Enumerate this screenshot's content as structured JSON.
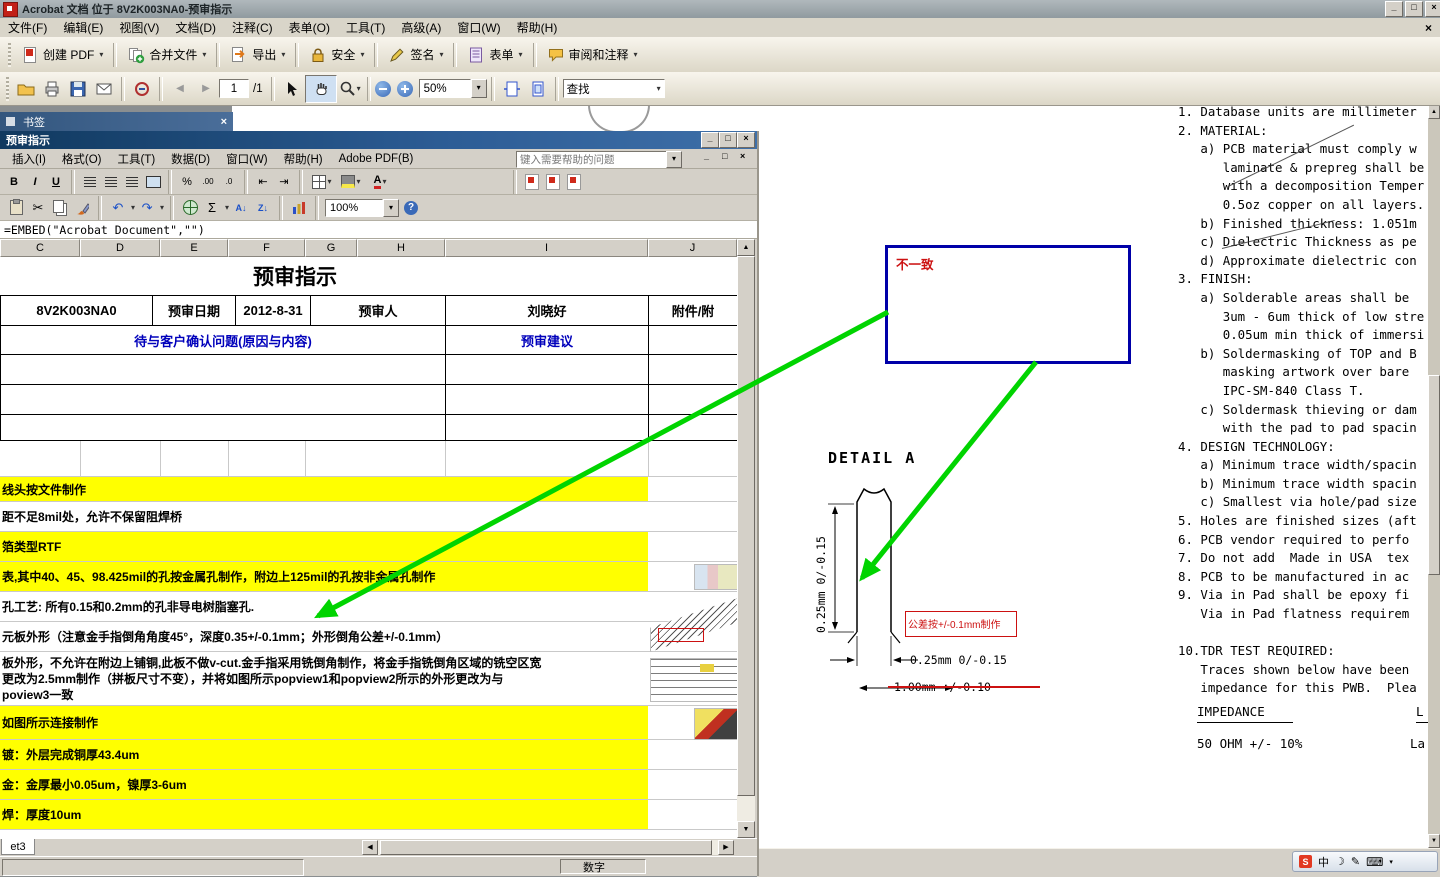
{
  "colors": {
    "c-hl": "#ffff00",
    "c-arrow": "#00d400",
    "c-callout": "#0000a8",
    "c-red": "#cc1111",
    "c-blue-text": "#0000bb"
  },
  "icons": {
    "min": "_",
    "max": "□",
    "close": "×",
    "dd": "▾",
    "up": "▲",
    "down": "▼",
    "left": "◀",
    "right": "▶",
    "bold": "B",
    "italic": "I",
    "underline": "U",
    "percent": "%",
    "dec_inc": ".00",
    "dec_dec": ".0",
    "indent_dec": "⇤",
    "indent_inc": "⇥",
    "scissors": "✂",
    "undo": "↶",
    "redo": "↷",
    "sum": "Σ",
    "help": "?",
    "fontA": "A",
    "sort_az": "A↓",
    "sort_za": "Z↓",
    "sogou": "S",
    "lang": "中",
    "moon": "☽",
    "pen": "✎",
    "keyboard": "⌨"
  },
  "window": {
    "title": "Acrobat 文档 位于 8V2K003NA0-预审指示"
  },
  "menubar": {
    "items": [
      "文件(F)",
      "编辑(E)",
      "视图(V)",
      "文档(D)",
      "注释(C)",
      "表单(O)",
      "工具(T)",
      "高级(A)",
      "窗口(W)",
      "帮助(H)"
    ]
  },
  "taskbar": {
    "buttons": [
      "创建 PDF",
      "合并文件",
      "导出",
      "安全",
      "签名",
      "表单",
      "审阅和注释"
    ]
  },
  "toolbar": {
    "page_value": "1",
    "page_total": "/1",
    "zoom_value": "50%",
    "find_value": "查找"
  },
  "nav": {
    "bookmarks": "书签"
  },
  "excel": {
    "title": "预审指示",
    "menu": [
      "插入(I)",
      "格式(O)",
      "工具(T)",
      "数据(D)",
      "窗口(W)",
      "帮助(H)",
      "Adobe PDF(B)"
    ],
    "help_placeholder": "键入需要帮助的问题",
    "zoom": "100%",
    "formula": "=EMBED(\"Acrobat Document\",\"\")",
    "columns": [
      "C",
      "D",
      "E",
      "F",
      "G",
      "H",
      "I",
      "J"
    ],
    "sheet": {
      "title": "预审指示",
      "info_row": {
        "part": "8V2K003NA0",
        "date_label": "预审日期",
        "date": "2012-8-31",
        "reviewer_label": "预审人",
        "reviewer": "刘晓好",
        "attach_label": "附件/附"
      },
      "section_row": {
        "left": "待与客户确认问题(原因与内容)",
        "right": "预审建议"
      },
      "rows": [
        {
          "text": "线头按文件制作",
          "highlight": true
        },
        {
          "text": "距不足8mil处，允许不保留阻焊桥",
          "highlight": false
        },
        {
          "text": "箔类型RTF",
          "highlight": true
        },
        {
          "text": "表,其中40、45、98.425mil的孔按金属孔制作，附边上125mil的孔按非金属孔制作",
          "highlight": true
        },
        {
          "text": "孔工艺: 所有0.15和0.2mm的孔非导电树脂塞孔.",
          "highlight": false
        },
        {
          "text": "元板外形（注意金手指倒角角度45°，深度0.35+/-0.1mm；外形倒角公差+/-0.1mm）",
          "highlight": false
        },
        {
          "text": "板外形，不允许在附边上铺铜,此板不做v-cut.金手指采用铣倒角制作，将金手指铣倒角区域的铣空区宽\n更改为2.5mm制作（拼板尺寸不变），并将如图所示popview1和popview2所示的外形更改为与\npoview3一致",
          "highlight": false
        },
        {
          "text": "如图所示连接制作",
          "highlight": true
        },
        {
          "text": "镀：外层完成铜厚43.4um",
          "highlight": true
        },
        {
          "text": "金：金厚最小0.05um，镍厚3-6um",
          "highlight": true
        },
        {
          "text": "焊：厚度10um",
          "highlight": true
        }
      ],
      "tab": "et3",
      "status": "数字"
    }
  },
  "pdf": {
    "callout": "不一致",
    "detail": {
      "title": "DETAIL A",
      "dim_vertical": "0.25mm 0/-0.15",
      "dim_width": "0.25mm 0/-0.15",
      "dim_pitch": "1.00mm +/-0.10",
      "tolerance_note": "公差按+/-0.1mm制作"
    },
    "notes": [
      "1. Database units are millimeter",
      "2. MATERIAL:",
      "   a) PCB material must comply w",
      "      laminate & prepreg shall be",
      "      with a decomposition Temper",
      "      0.5oz copper on all layers.",
      "   b) Finished thickness: 1.051m",
      "   c) Dielectric Thickness as pe",
      "   d) Approximate dielectric con",
      "3. FINISH:",
      "   a) Solderable areas shall be",
      "      3um - 6um thick of low stre",
      "      0.05um min thick of immersi",
      "   b) Soldermasking of TOP and B",
      "      masking artwork over bare",
      "      IPC-SM-840 Class T.",
      "   c) Soldermask thieving or dam",
      "      with the pad to pad spacin",
      "4. DESIGN TECHNOLOGY:",
      "   a) Minimum trace width/spacin",
      "   b) Minimum trace width spacin",
      "   c) Smallest via hole/pad size",
      "5. Holes are finished sizes (aft",
      "6. PCB vendor required to perfo",
      "7. Do not add  Made in USA  tex",
      "8. PCB to be manufactured in ac",
      "9. Via in Pad shall be epoxy fi",
      "   Via in Pad flatness requirem",
      "",
      "10.TDR TEST REQUIRED:",
      "   Traces shown below have been",
      "   impedance for this PWB.  Plea"
    ],
    "impedance": {
      "header": "IMPEDANCE",
      "header_right": "L",
      "row": "50 OHM +/- 10%",
      "row_right": "La"
    }
  }
}
